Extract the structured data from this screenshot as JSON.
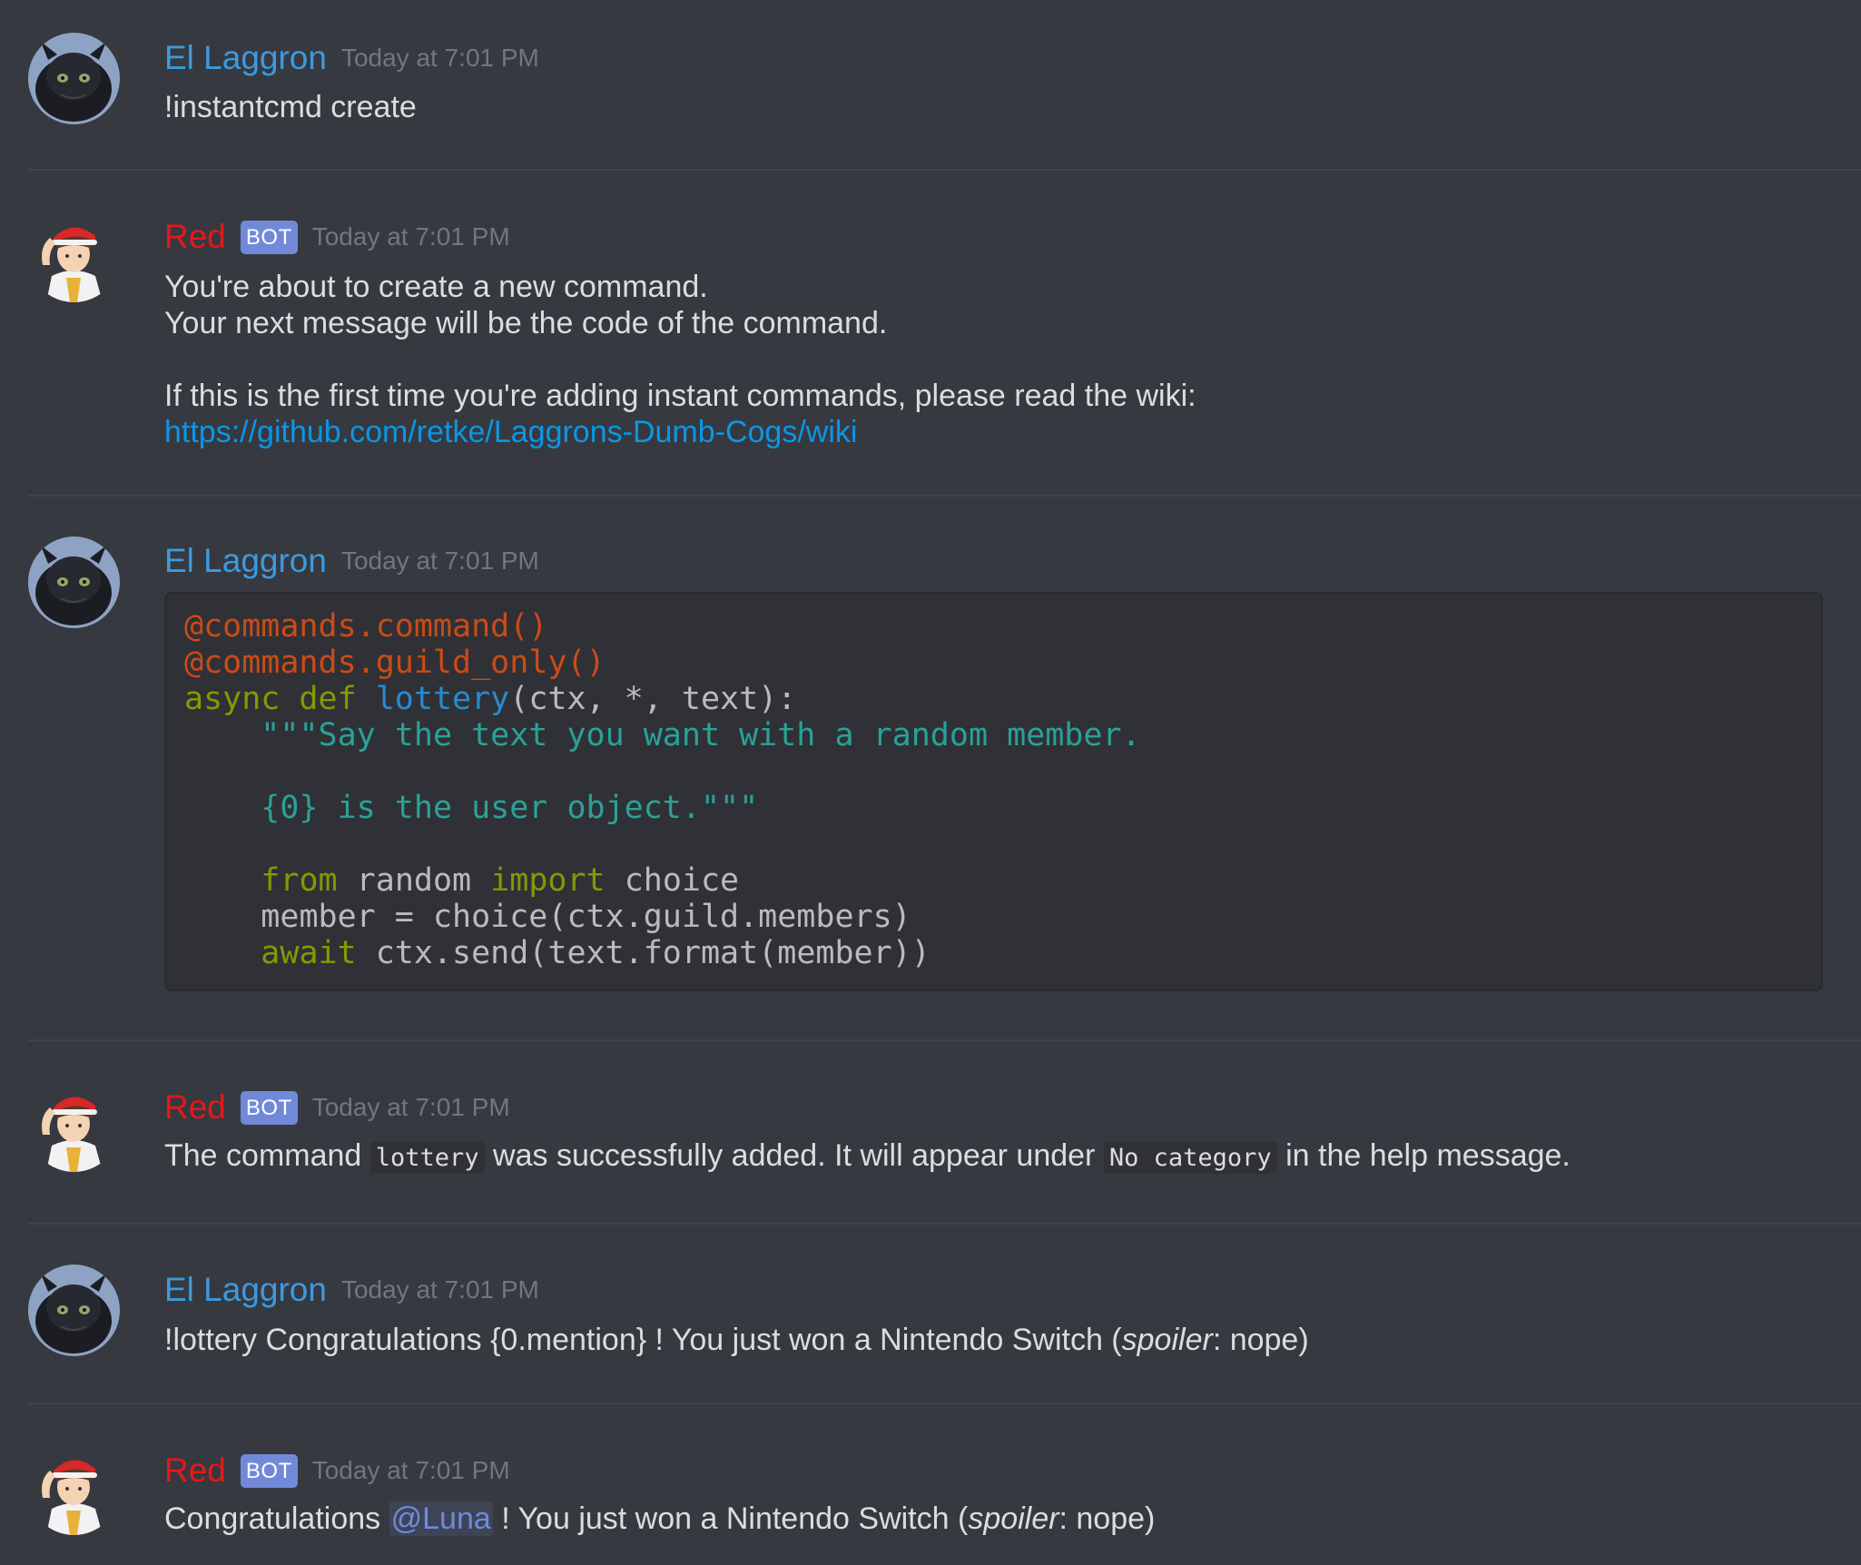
{
  "messages": [
    {
      "author": "El Laggron",
      "timestamp": "Today at 7:01 PM",
      "avatar": "dragon-avatar",
      "text": "!instantcmd create"
    },
    {
      "author": "Red",
      "badge": "BOT",
      "timestamp": "Today at 7:01 PM",
      "avatar": "trainer-avatar",
      "lines": [
        "You're about to create a new command.",
        "Your next message will be the code of the command.",
        "If this is the first time you're adding instant commands, please read the wiki:"
      ],
      "link": "https://github.com/retke/Laggrons-Dumb-Cogs/wiki"
    },
    {
      "author": "El Laggron",
      "timestamp": "Today at 7:01 PM",
      "avatar": "dragon-avatar",
      "code": {
        "l1": "@commands.command()",
        "l2": "@commands.guild_only()",
        "l3_kw": "async def",
        "l3_fn": "lottery",
        "l3_rest": "(ctx, *, text):",
        "l4": "\"\"\"Say the text you want with a random member.",
        "l6": "{0} is the user object.\"\"\"",
        "l8_kw1": "from",
        "l8_mid": "random",
        "l8_kw2": "import",
        "l8_end": "choice",
        "l9": "member = choice(ctx.guild.members)",
        "l10_kw": "await",
        "l10_rest": "ctx.send(text.format(member))"
      }
    },
    {
      "author": "Red",
      "badge": "BOT",
      "timestamp": "Today at 7:01 PM",
      "avatar": "trainer-avatar",
      "t1": "The command",
      "code1": "lottery",
      "t2": "was successfully added. It will appear under",
      "code2": "No category",
      "t3": "in the help message."
    },
    {
      "author": "El Laggron",
      "timestamp": "Today at 7:01 PM",
      "avatar": "dragon-avatar",
      "t1": "!lottery Congratulations {0.mention} ! You just won a Nintendo Switch (",
      "em": "spoiler",
      "t2": ": nope)"
    },
    {
      "author": "Red",
      "badge": "BOT",
      "timestamp": "Today at 7:01 PM",
      "avatar": "trainer-avatar",
      "t1": "Congratulations",
      "mention": "@Luna",
      "t2": "! You just won a Nintendo Switch (",
      "em": "spoiler",
      "t3": ": nope)"
    }
  ],
  "colors": {
    "background": "#36393f",
    "user_name": "#3b9ae0",
    "bot_name": "#e8161a",
    "bot_badge": "#7289da",
    "link": "#0b96e6"
  }
}
